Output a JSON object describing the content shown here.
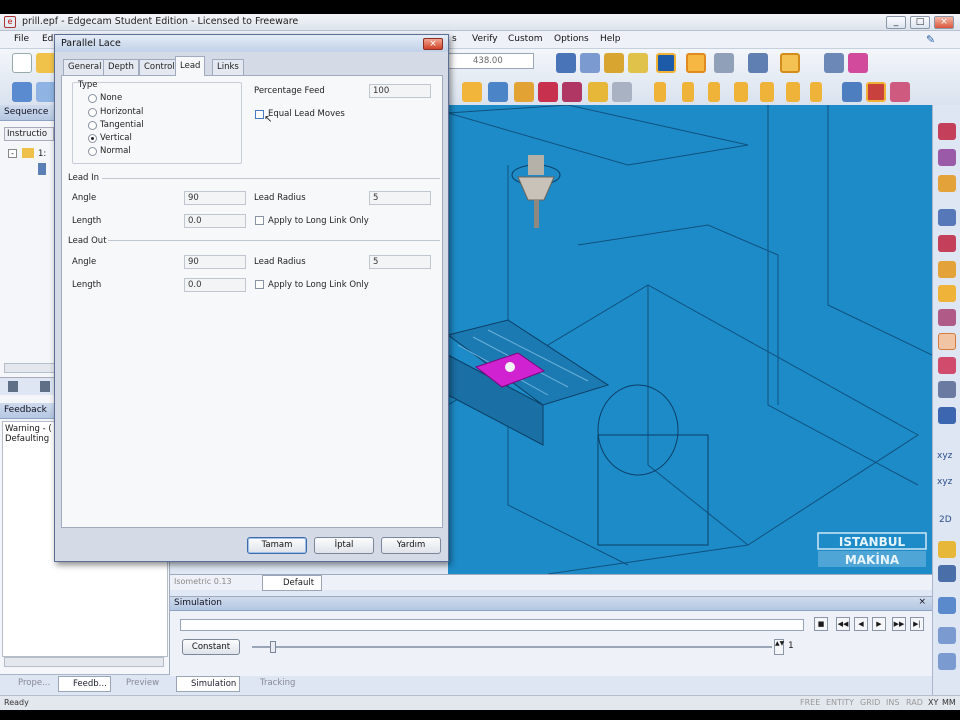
{
  "window": {
    "title": "prill.epf - Edgecam Student Edition - Licensed to Freeware"
  },
  "menu": {
    "file": "File",
    "edit": "Ed",
    "s": "s",
    "verify": "Verify",
    "custom": "Custom",
    "options": "Options",
    "help": "Help"
  },
  "toolbar": {
    "zoom_value": "438.00"
  },
  "left_panel": {
    "sequence_header": "Sequence",
    "instructions_col": "Instructio",
    "tree_item": "1:",
    "feedback_header": "Feedback",
    "feedback_lines": [
      "Warning - (",
      "Defaulting"
    ]
  },
  "bottom_tabs": {
    "properties": "Prope...",
    "feedback": "Feedb...",
    "preview": "Preview",
    "simulation": "Simulation",
    "tracking": "Tracking"
  },
  "dialog": {
    "title": "Parallel Lace",
    "tabs": [
      "General",
      "Depth",
      "Control",
      "Lead",
      "Links"
    ],
    "active_tab": "Lead",
    "type_group": "Type",
    "type_options": [
      "None",
      "Horizontal",
      "Tangential",
      "Vertical",
      "Normal"
    ],
    "type_selected": "Vertical",
    "percentage_feed_label": "Percentage Feed",
    "percentage_feed_value": "100",
    "equal_lead_moves_label": "Equal Lead Moves",
    "lead_in": {
      "section": "Lead In",
      "angle_label": "Angle",
      "angle_value": "90",
      "length_label": "Length",
      "length_value": "0.0",
      "radius_label": "Lead Radius",
      "radius_value": "5",
      "apply_label": "Apply to Long Link Only"
    },
    "lead_out": {
      "section": "Lead Out",
      "angle_label": "Angle",
      "angle_value": "90",
      "length_label": "Length",
      "length_value": "0.0",
      "radius_label": "Lead Radius",
      "radius_value": "5",
      "apply_label": "Apply to Long Link Only"
    },
    "buttons": {
      "ok": "Tamam",
      "cancel": "İptal",
      "help": "Yardım"
    }
  },
  "viewport": {
    "view_label": "Isometric 0.13",
    "default_label": "Default",
    "watermark_top": "ISTANBUL",
    "watermark_bottom": "MAKİNA"
  },
  "simulation": {
    "header": "Simulation",
    "mode_button": "Constant",
    "speed_value": "1"
  },
  "right_toolbar": {
    "xyz1": "xyz",
    "xyz2": "xyz",
    "twod": "2D"
  },
  "status": {
    "ready": "Ready",
    "free": "FREE",
    "entity": "ENTITY",
    "grid": "GRID",
    "ins": "INS",
    "rad": "RAD",
    "xy": "XY",
    "mm": "MM"
  },
  "colors": {
    "viewport": "#1d8bc8",
    "dialog_bg": "#d4dbe7",
    "part": "#cc22cc",
    "accent": "#3f6aa8"
  }
}
